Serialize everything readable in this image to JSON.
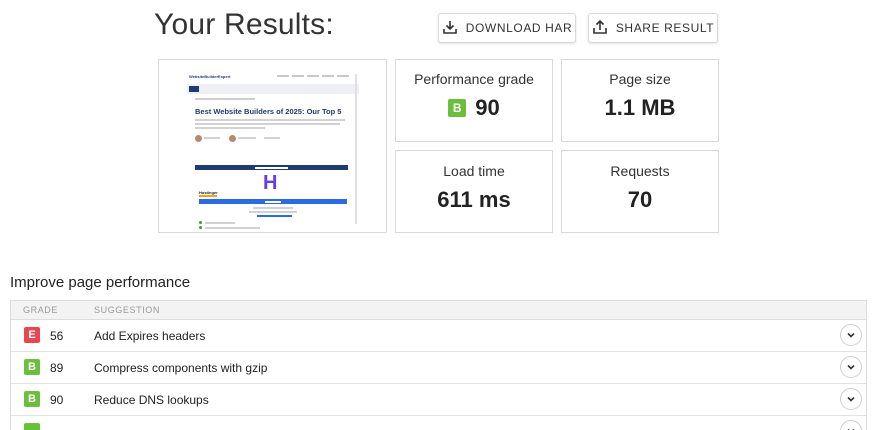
{
  "header": {
    "title": "Your Results:",
    "download_label": "DOWNLOAD HAR",
    "share_label": "SHARE RESULT"
  },
  "screenshot_thumb": {
    "logo": "WebsiteBuilderExpert",
    "headline": "Best Website Builders of 2025: Our Top 5",
    "featured_name": "Hostinger"
  },
  "metrics": {
    "performance": {
      "label": "Performance grade",
      "grade": "B",
      "value": "90",
      "grade_color": "#6cbf3d"
    },
    "page_size": {
      "label": "Page size",
      "value": "1.1 MB"
    },
    "load_time": {
      "label": "Load time",
      "value": "611 ms"
    },
    "requests": {
      "label": "Requests",
      "value": "70"
    }
  },
  "improve": {
    "title": "Improve page performance",
    "columns": {
      "grade": "GRADE",
      "suggestion": "SUGGESTION"
    },
    "rows": [
      {
        "grade": "E",
        "score": "56",
        "suggestion": "Add Expires headers",
        "color": "#e8484d"
      },
      {
        "grade": "B",
        "score": "89",
        "suggestion": "Compress components with gzip",
        "color": "#6cbf3d"
      },
      {
        "grade": "B",
        "score": "90",
        "suggestion": "Reduce DNS lookups",
        "color": "#6cbf3d"
      },
      {
        "grade": "",
        "score": "",
        "suggestion": "",
        "color": "#6cbf3d"
      }
    ]
  },
  "icons": {
    "download": "download-icon",
    "share": "share-icon",
    "expand": "chevron-down-icon"
  }
}
